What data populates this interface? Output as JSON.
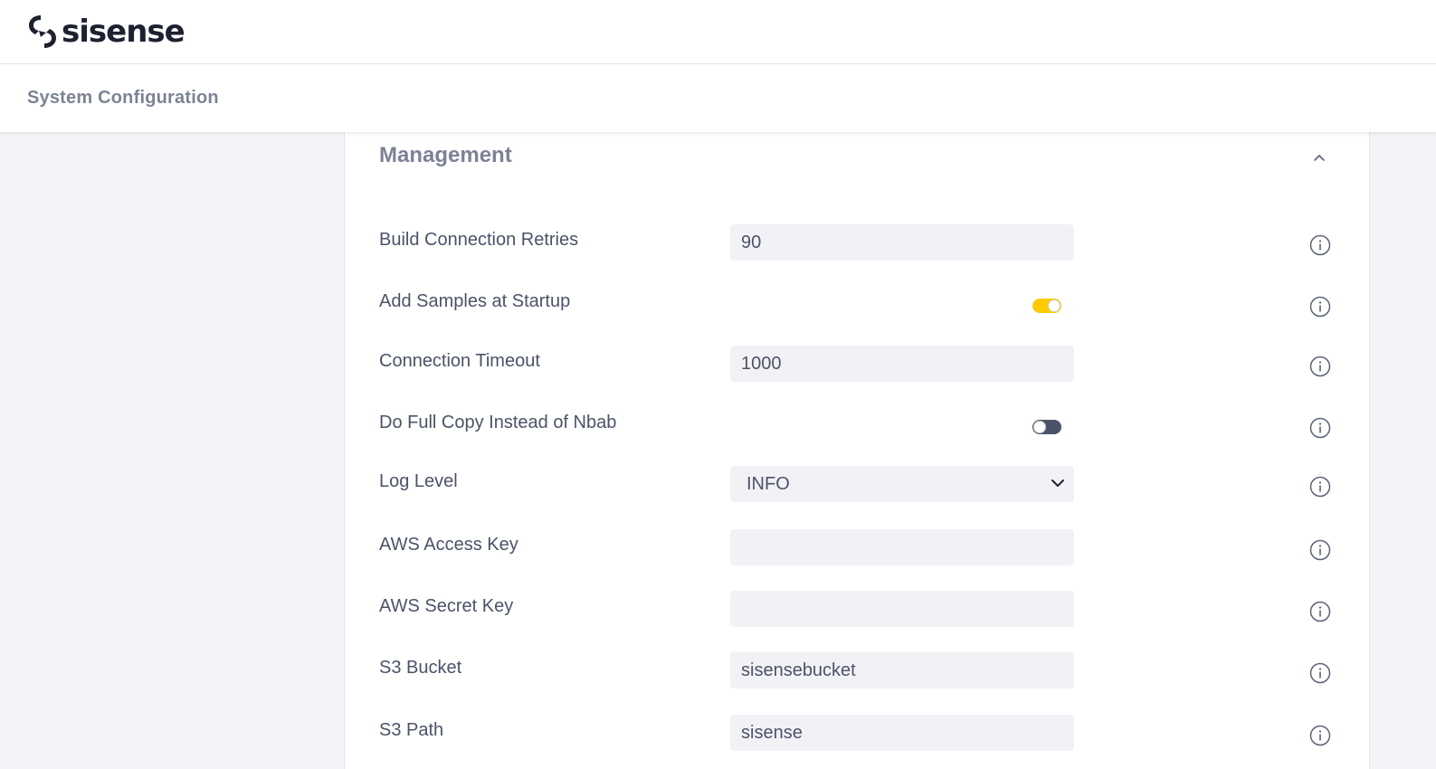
{
  "brand": {
    "name": "sisense"
  },
  "header": {
    "title": "System Configuration"
  },
  "section": {
    "title": "Management",
    "collapse_icon": "chevron-up-icon"
  },
  "settings": [
    {
      "label": "Build Connection Retries",
      "type": "text",
      "value": "90",
      "info_icon": "info-icon"
    },
    {
      "label": "Add Samples at Startup",
      "type": "toggle",
      "value": "on",
      "info_icon": "info-icon"
    },
    {
      "label": "Connection Timeout",
      "type": "text",
      "value": "1000",
      "info_icon": "info-icon"
    },
    {
      "label": "Do Full Copy Instead of Nbab",
      "type": "toggle",
      "value": "off",
      "info_icon": "info-icon"
    },
    {
      "label": "Log Level",
      "type": "select",
      "value": "INFO",
      "info_icon": "info-icon"
    },
    {
      "label": "AWS Access Key",
      "type": "text",
      "value": "",
      "info_icon": "info-icon"
    },
    {
      "label": "AWS Secret Key",
      "type": "text",
      "value": "",
      "info_icon": "info-icon"
    },
    {
      "label": "S3 Bucket",
      "type": "text",
      "value": "sisensebucket",
      "info_icon": "info-icon"
    },
    {
      "label": "S3 Path",
      "type": "text",
      "value": "sisense",
      "info_icon": "info-icon"
    }
  ],
  "colors": {
    "toggle_on": "#ffcb05",
    "toggle_off": "#4b5368",
    "input_bg": "#f2f2f6",
    "text": "#4b5368",
    "heading": "#7c8396"
  }
}
